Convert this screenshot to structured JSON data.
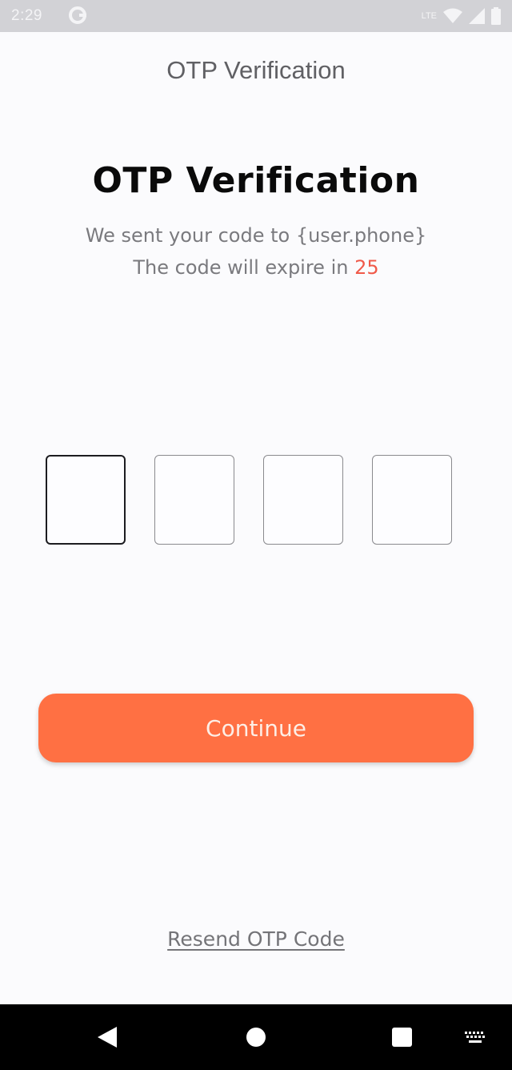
{
  "status_bar": {
    "time": "2:29",
    "lte": "LTE"
  },
  "app_bar": {
    "title": "OTP Verification"
  },
  "main": {
    "heading": "OTP Verification",
    "sent_text": "We sent your code to {user.phone}",
    "expire_text": "The code will expire in ",
    "expire_count": "25"
  },
  "otp": {
    "fields": [
      "",
      "",
      "",
      ""
    ]
  },
  "actions": {
    "continue_label": "Continue",
    "resend_label": "Resend OTP Code"
  },
  "colors": {
    "accent": "#ff7043",
    "countdown": "#f05a4a"
  }
}
